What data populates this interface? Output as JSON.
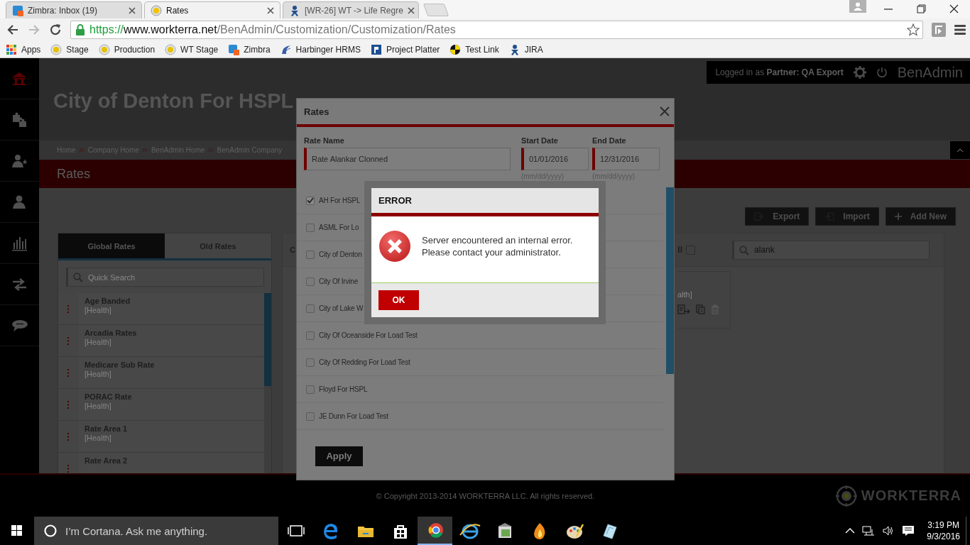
{
  "browser": {
    "tabs": [
      {
        "title": "Zimbra: Inbox (19)",
        "selected": false
      },
      {
        "title": "Rates",
        "selected": true
      },
      {
        "title": "[WR-26] WT -> Life Regre",
        "selected": false
      }
    ],
    "url": {
      "scheme": "https://",
      "host": "www.workterra.net",
      "path": "/BenAdmin/Customization/Customization/Rates"
    },
    "bookmarks": [
      "Apps",
      "Stage",
      "Production",
      "WT Stage",
      "Zimbra",
      "Harbinger HRMS",
      "Project Platter",
      "Test Link",
      "JIRA"
    ]
  },
  "app": {
    "nav": [
      {
        "selected": true
      },
      {
        "selected": false
      },
      {
        "selected": false
      },
      {
        "selected": false
      },
      {
        "selected": false
      },
      {
        "selected": false
      },
      {
        "selected": false
      }
    ],
    "header": {
      "title": "City of Denton For HSPL",
      "login": "Logged in as **Partner:  QA Export**",
      "product": "BenAdmin"
    },
    "breadcrumb": [
      "Home",
      "Company Home",
      "BenAdmin Home",
      "BenAdmin Company"
    ],
    "page_title": "Rates",
    "actions": [
      {
        "label": "Export",
        "kind": "export"
      },
      {
        "label": "Import",
        "kind": "import"
      },
      {
        "label": "Add New",
        "kind": "add"
      }
    ],
    "rate_tabs": [
      {
        "label": "Global Rates",
        "selected": true
      },
      {
        "label": "Old Rates",
        "selected": false
      }
    ],
    "quick_search": {
      "placeholder": "Quick Search"
    },
    "rates": [
      {
        "name": "Age Banded",
        "category": "[Health]"
      },
      {
        "name": "Arcadia Rates",
        "category": "[Health]"
      },
      {
        "name": "Medicare Sub Rate",
        "category": "[Health]"
      },
      {
        "name": "PORAC Rate",
        "category": "[Health]"
      },
      {
        "name": "Rate Area 1",
        "category": "[Health]"
      },
      {
        "name": "Rate Area 2"
      }
    ],
    "middle": {
      "heading": "C",
      "select_all": {
        "label": "ll",
        "checked": false
      },
      "search": {
        "value": "alank"
      },
      "card": {
        "category": "alth]"
      }
    },
    "footer": {
      "copyright": "© Copyright 2013-2014 WORKTERRA LLC. All rights reserved.",
      "logo": "WORKTERRA"
    }
  },
  "rates_modal": {
    "title": "Rates",
    "fields": [
      {
        "label": "Rate Name",
        "value": "Rate Alankar Clonned"
      },
      {
        "label": "Start Date",
        "value": "01/01/2016",
        "hint": "(mm/dd/yyyy)"
      },
      {
        "label": "End Date",
        "value": "12/31/2016",
        "hint": "(mm/dd/yyyy)"
      }
    ],
    "items": [
      {
        "label": "AH For HSPL",
        "checked": true
      },
      {
        "label": "ASML For Lo",
        "checked": false
      },
      {
        "label": "City of Denton",
        "checked": false
      },
      {
        "label": "City Of Irvine",
        "checked": false
      },
      {
        "label": "City of Lake W",
        "checked": false
      },
      {
        "label": "City Of Oceanside For Load Test",
        "checked": false
      },
      {
        "label": "City Of Redding For Load Test",
        "checked": false
      },
      {
        "label": "Floyd For HSPL",
        "checked": false
      },
      {
        "label": "JE Dunn For Load Test",
        "checked": false
      }
    ],
    "apply": "Apply"
  },
  "error_dialog": {
    "title": "ERROR",
    "message": "Server encountered an internal error.\nPlease contact your administrator.",
    "ok": "OK"
  },
  "taskbar": {
    "search_placeholder": "I’m Cortana. Ask me anything.",
    "time": "3:19 PM",
    "date": "9/3/2016"
  }
}
